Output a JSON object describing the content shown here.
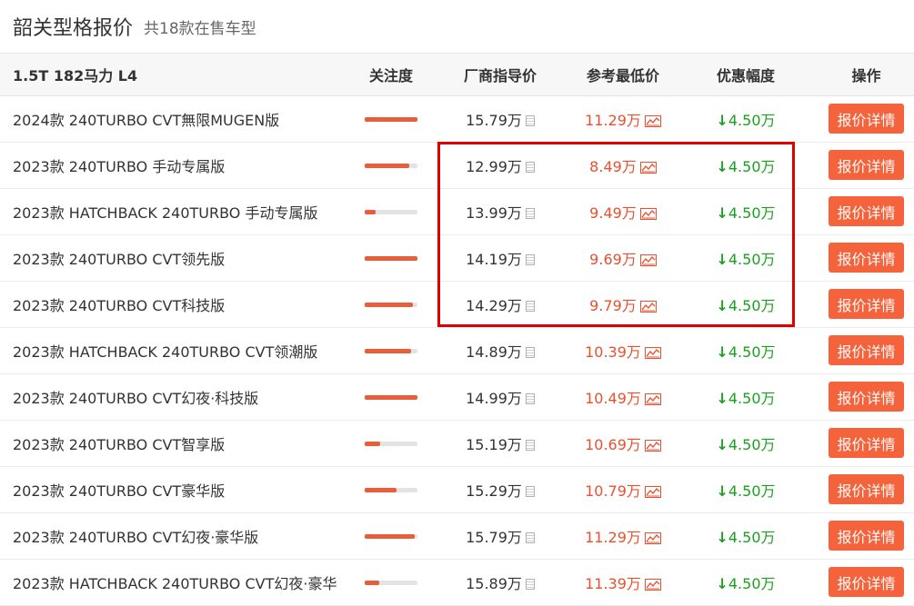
{
  "header": {
    "title": "韶关型格报价",
    "subtitle": "共18款在售车型"
  },
  "table": {
    "columns": {
      "engine": "1.5T 182马力 L4",
      "attention": "关注度",
      "guide": "厂商指导价",
      "lowest": "参考最低价",
      "discount": "优惠幅度",
      "action": "操作"
    },
    "rows": [
      {
        "name": "2024款 240TURBO CVT無限MUGEN版",
        "attention": 1.0,
        "guide": "15.79万",
        "lowest": "11.29万",
        "discount": "4.50万",
        "action": "报价详情"
      },
      {
        "name": "2023款 240TURBO 手动专属版",
        "attention": 0.85,
        "guide": "12.99万",
        "lowest": "8.49万",
        "discount": "4.50万",
        "action": "报价详情"
      },
      {
        "name": "2023款 HATCHBACK 240TURBO 手动专属版",
        "attention": 0.2,
        "guide": "13.99万",
        "lowest": "9.49万",
        "discount": "4.50万",
        "action": "报价详情"
      },
      {
        "name": "2023款 240TURBO CVT领先版",
        "attention": 1.0,
        "guide": "14.19万",
        "lowest": "9.69万",
        "discount": "4.50万",
        "action": "报价详情"
      },
      {
        "name": "2023款 240TURBO CVT科技版",
        "attention": 0.92,
        "guide": "14.29万",
        "lowest": "9.79万",
        "discount": "4.50万",
        "action": "报价详情"
      },
      {
        "name": "2023款 HATCHBACK 240TURBO CVT领潮版",
        "attention": 0.88,
        "guide": "14.89万",
        "lowest": "10.39万",
        "discount": "4.50万",
        "action": "报价详情"
      },
      {
        "name": "2023款 240TURBO CVT幻夜·科技版",
        "attention": 1.0,
        "guide": "14.99万",
        "lowest": "10.49万",
        "discount": "4.50万",
        "action": "报价详情"
      },
      {
        "name": "2023款 240TURBO CVT智享版",
        "attention": 0.3,
        "guide": "15.19万",
        "lowest": "10.69万",
        "discount": "4.50万",
        "action": "报价详情"
      },
      {
        "name": "2023款 240TURBO CVT豪华版",
        "attention": 0.6,
        "guide": "15.29万",
        "lowest": "10.79万",
        "discount": "4.50万",
        "action": "报价详情"
      },
      {
        "name": "2023款 240TURBO CVT幻夜·豪华版",
        "attention": 0.95,
        "guide": "15.79万",
        "lowest": "11.29万",
        "discount": "4.50万",
        "action": "报价详情"
      },
      {
        "name": "2023款 HATCHBACK 240TURBO CVT幻夜·豪华",
        "attention": 0.27,
        "guide": "15.89万",
        "lowest": "11.39万",
        "discount": "4.50万",
        "action": "报价详情"
      }
    ]
  },
  "icons": {
    "guide_icon": "calculator-icon",
    "lowest_icon": "price-trend-icon",
    "discount_icon": "down-arrow-icon"
  },
  "colors": {
    "accent": "#f4633c",
    "low_price": "#e8502f",
    "discount": "#1aa01e",
    "highlight": "#e00000"
  }
}
